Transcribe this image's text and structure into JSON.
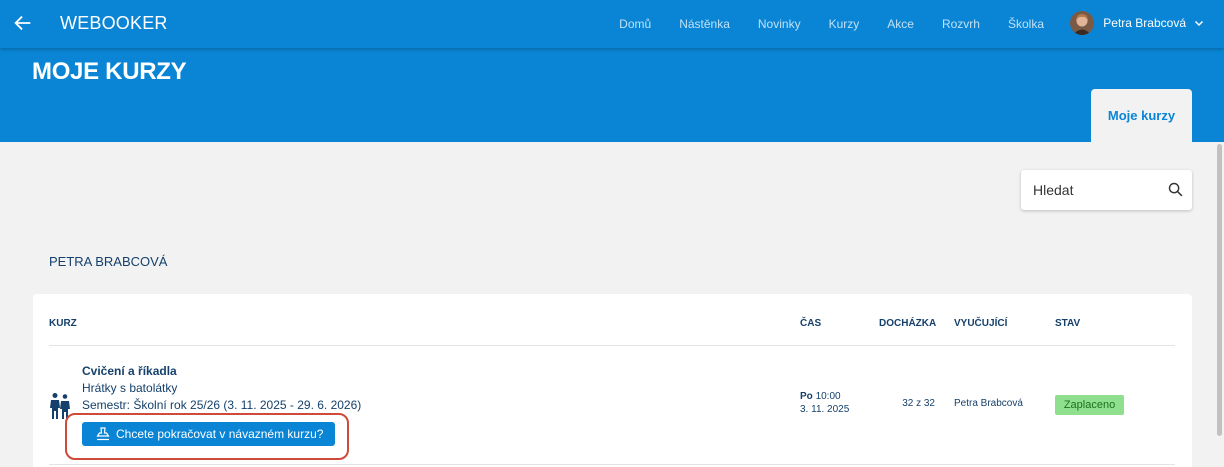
{
  "header": {
    "brand": "WEBOOKER",
    "nav": [
      "Domů",
      "Nástěnka",
      "Novinky",
      "Kurzy",
      "Akce",
      "Rozvrh",
      "Školka"
    ],
    "user_name": "Petra Brabcová",
    "icons": {
      "back": "arrow-left-icon",
      "user_menu": "chevron-down-icon",
      "avatar": "user-avatar"
    }
  },
  "hero": {
    "title": "MOJE KURZY",
    "active_tab": "Moje kurzy"
  },
  "search": {
    "placeholder": "Hledat",
    "value": "",
    "icon": "search-icon"
  },
  "person": "PETRA BRABCOVÁ",
  "table": {
    "columns": {
      "course": "KURZ",
      "time": "ČAS",
      "attendance": "DOCHÁZKA",
      "teacher": "VYUČUJÍCÍ",
      "status": "STAV"
    },
    "rows": [
      {
        "icon": "children-icon",
        "name": "Cvičení a říkadla",
        "subtitle": "Hrátky s batolátky",
        "semester": "Semestr: Školní rok 25/26 (3. 11. 2025 - 29. 6. 2026)",
        "continue_button": "Chcete pokračovat v návazném kurzu?",
        "time_day": "Po",
        "time_hour": "10:00",
        "time_date": "3. 11. 2025",
        "attendance": "32 z 32",
        "teacher": "Petra Brabcová",
        "status": "Zaplaceno"
      }
    ]
  },
  "colors": {
    "primary": "#0a85d5",
    "background": "#f2f2f2",
    "text_dark": "#15406b",
    "status_paid_bg": "#8ee08e",
    "status_paid_text": "#1e6e1e",
    "highlight": "#cf4a3a"
  }
}
